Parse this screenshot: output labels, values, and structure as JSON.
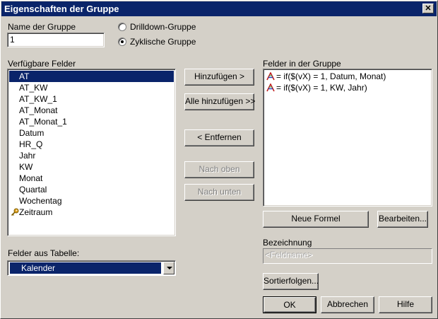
{
  "window": {
    "title": "Eigenschaften der Gruppe",
    "close_glyph": "✕"
  },
  "group_name": {
    "label": "Name der Gruppe",
    "value": "1"
  },
  "group_type": {
    "options": [
      {
        "label": "Drilldown-Gruppe",
        "selected": false
      },
      {
        "label": "Zyklische Gruppe",
        "selected": true
      }
    ]
  },
  "available_fields": {
    "label": "Verfügbare Felder",
    "items": [
      {
        "label": "AT",
        "selected": true,
        "icon": ""
      },
      {
        "label": "AT_KW",
        "selected": false,
        "icon": ""
      },
      {
        "label": "AT_KW_1",
        "selected": false,
        "icon": ""
      },
      {
        "label": "AT_Monat",
        "selected": false,
        "icon": ""
      },
      {
        "label": "AT_Monat_1",
        "selected": false,
        "icon": ""
      },
      {
        "label": "Datum",
        "selected": false,
        "icon": ""
      },
      {
        "label": "HR_Q",
        "selected": false,
        "icon": ""
      },
      {
        "label": "Jahr",
        "selected": false,
        "icon": ""
      },
      {
        "label": "KW",
        "selected": false,
        "icon": ""
      },
      {
        "label": "Monat",
        "selected": false,
        "icon": ""
      },
      {
        "label": "Quartal",
        "selected": false,
        "icon": ""
      },
      {
        "label": "Wochentag",
        "selected": false,
        "icon": ""
      },
      {
        "label": "Zeitraum",
        "selected": false,
        "icon": "key-icon"
      }
    ]
  },
  "buttons": {
    "add": "Hinzufügen >",
    "add_all": "Alle hinzufügen >>",
    "remove": "< Entfernen",
    "move_up": "Nach oben",
    "move_down": "Nach unten",
    "new_formula": "Neue Formel",
    "edit": "Bearbeiten...",
    "sort_orders": "Sortierfolgen...",
    "ok": "OK",
    "cancel": "Abbrechen",
    "help": "Hilfe"
  },
  "group_fields": {
    "label": "Felder in der Gruppe",
    "items": [
      {
        "label": "= if($(vX) = 1, Datum, Monat)",
        "icon": "formula-icon"
      },
      {
        "label": "= if($(vX) = 1, KW, Jahr)",
        "icon": "formula-icon"
      }
    ]
  },
  "table_fields": {
    "label": "Felder aus Tabelle:",
    "selected": "Kalender"
  },
  "designation": {
    "label": "Bezeichnung",
    "placeholder": "<Feldname>"
  },
  "colors": {
    "title_bar": "#0a246a",
    "selection": "#0a246a",
    "face": "#d4d0c8"
  }
}
